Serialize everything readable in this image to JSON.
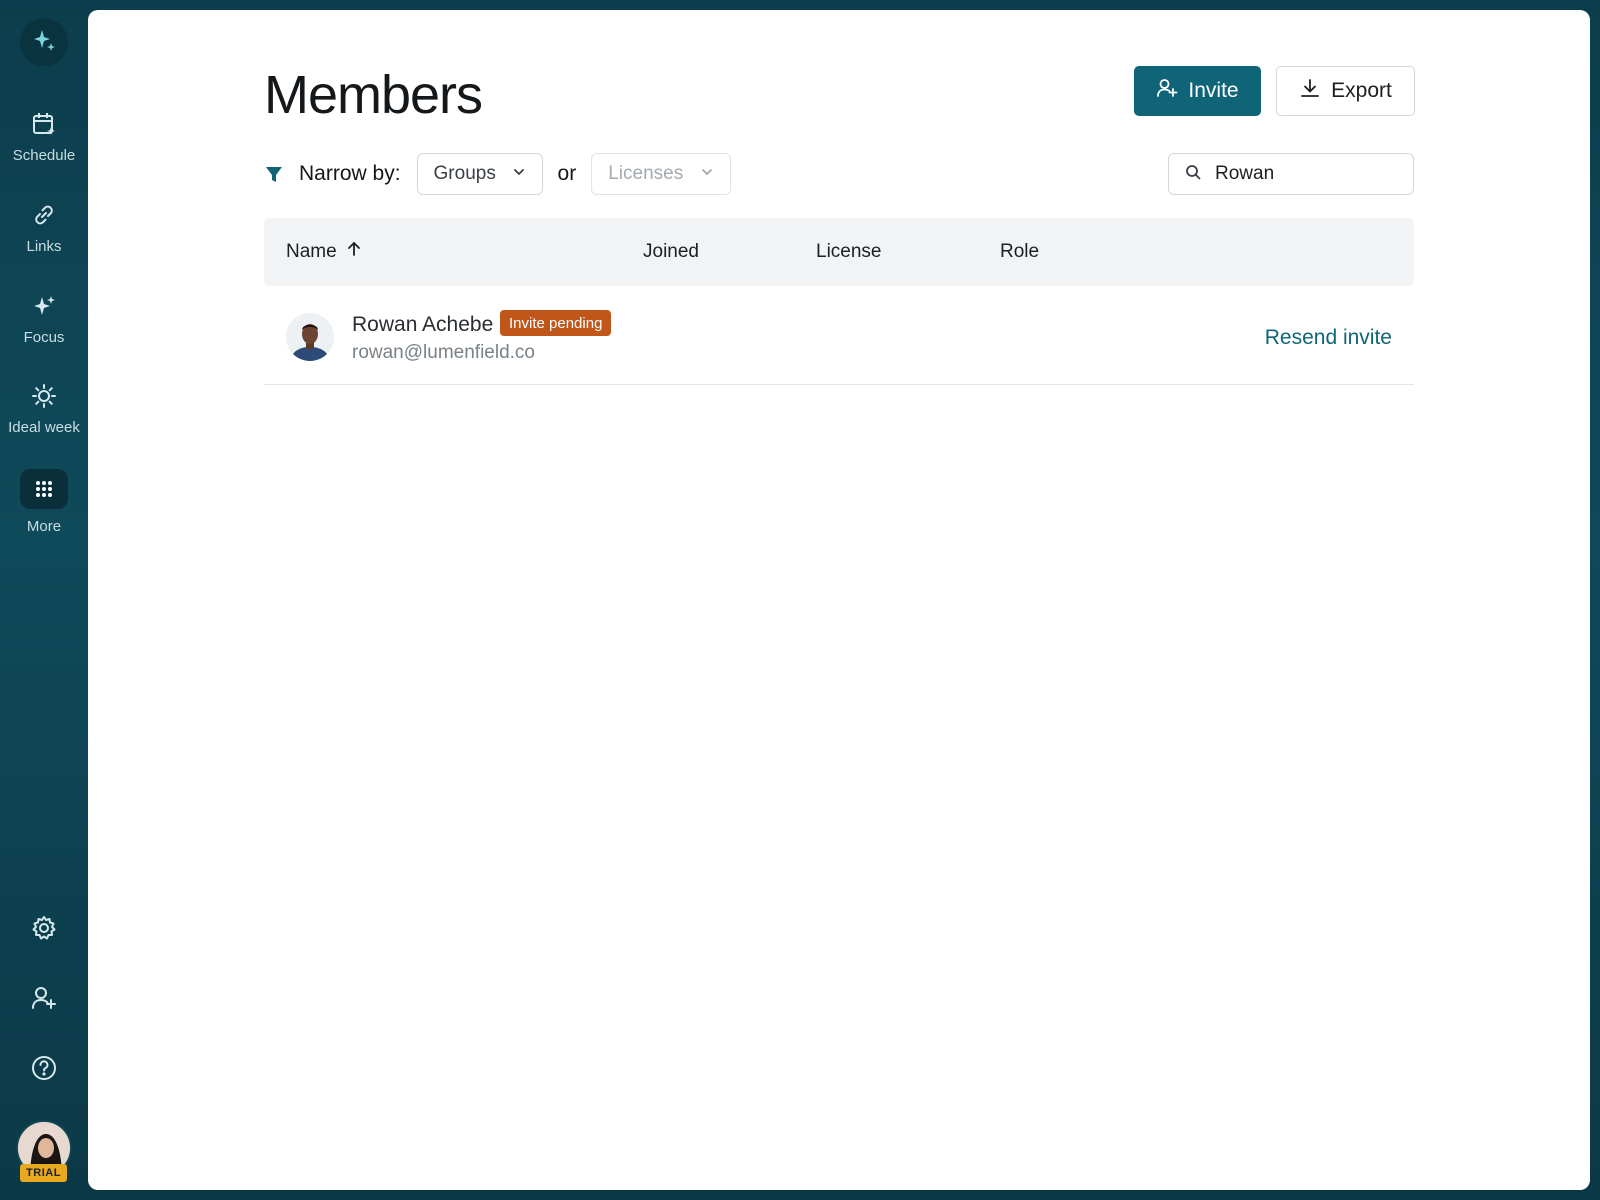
{
  "sidebar": {
    "items": [
      {
        "label": "Schedule",
        "icon": "calendar-icon"
      },
      {
        "label": "Links",
        "icon": "link-icon"
      },
      {
        "label": "Focus",
        "icon": "sparkles-icon"
      },
      {
        "label": "Ideal week",
        "icon": "sun-icon"
      },
      {
        "label": "More",
        "icon": "grid-icon"
      }
    ],
    "bottom_icons": [
      "gear-icon",
      "add-user-icon",
      "help-icon"
    ],
    "trial_badge": "TRIAL"
  },
  "page": {
    "title": "Members",
    "invite_label": "Invite",
    "export_label": "Export"
  },
  "filters": {
    "narrow_label": "Narrow by:",
    "groups_label": "Groups",
    "or_label": "or",
    "licenses_label": "Licenses",
    "search_value": "Rowan"
  },
  "table": {
    "columns": [
      "Name",
      "Joined",
      "License",
      "Role"
    ],
    "sort_column": "Name",
    "sort_direction": "ascending",
    "rows": [
      {
        "name": "Rowan Achebe",
        "badge": "Invite pending",
        "email": "rowan@lumenfield.co",
        "action": "Resend invite"
      }
    ]
  },
  "colors": {
    "accent": "#0f6577",
    "sidebar_bg": "#0f4a5a",
    "badge": "#c0561a",
    "trial": "#e8a921"
  }
}
